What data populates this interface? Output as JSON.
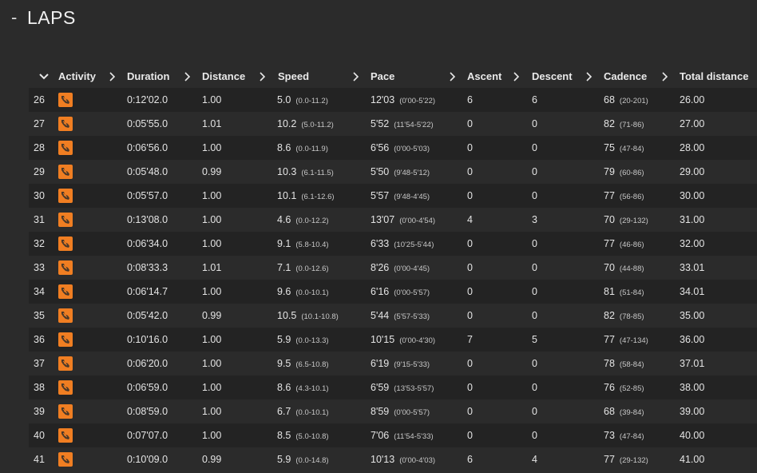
{
  "section": {
    "toggle": "-",
    "title": "LAPS"
  },
  "columns": [
    {
      "key": "activity",
      "label": "Activity"
    },
    {
      "key": "duration",
      "label": "Duration"
    },
    {
      "key": "distance",
      "label": "Distance"
    },
    {
      "key": "speed",
      "label": "Speed"
    },
    {
      "key": "pace",
      "label": "Pace"
    },
    {
      "key": "ascent",
      "label": "Ascent"
    },
    {
      "key": "descent",
      "label": "Descent"
    },
    {
      "key": "cadence",
      "label": "Cadence"
    },
    {
      "key": "total_distance",
      "label": "Total distance"
    }
  ],
  "activity_icon": "running-shoe-icon",
  "accent_color": "#f07e22",
  "laps": [
    {
      "num": "26",
      "duration": "0:12'02.0",
      "distance": "1.00",
      "speed": "5.0",
      "speed_range": "(0.0-11.2)",
      "pace": "12'03",
      "pace_range": "(0'00-5'22)",
      "ascent": "6",
      "descent": "6",
      "cadence": "68",
      "cadence_range": "(20-201)",
      "total": "26.00"
    },
    {
      "num": "27",
      "duration": "0:05'55.0",
      "distance": "1.01",
      "speed": "10.2",
      "speed_range": "(5.0-11.2)",
      "pace": "5'52",
      "pace_range": "(11'54-5'22)",
      "ascent": "0",
      "descent": "0",
      "cadence": "82",
      "cadence_range": "(71-86)",
      "total": "27.00"
    },
    {
      "num": "28",
      "duration": "0:06'56.0",
      "distance": "1.00",
      "speed": "8.6",
      "speed_range": "(0.0-11.9)",
      "pace": "6'56",
      "pace_range": "(0'00-5'03)",
      "ascent": "0",
      "descent": "0",
      "cadence": "75",
      "cadence_range": "(47-84)",
      "total": "28.00"
    },
    {
      "num": "29",
      "duration": "0:05'48.0",
      "distance": "0.99",
      "speed": "10.3",
      "speed_range": "(6.1-11.5)",
      "pace": "5'50",
      "pace_range": "(9'48-5'12)",
      "ascent": "0",
      "descent": "0",
      "cadence": "79",
      "cadence_range": "(60-86)",
      "total": "29.00"
    },
    {
      "num": "30",
      "duration": "0:05'57.0",
      "distance": "1.00",
      "speed": "10.1",
      "speed_range": "(6.1-12.6)",
      "pace": "5'57",
      "pace_range": "(9'48-4'45)",
      "ascent": "0",
      "descent": "0",
      "cadence": "77",
      "cadence_range": "(56-86)",
      "total": "30.00"
    },
    {
      "num": "31",
      "duration": "0:13'08.0",
      "distance": "1.00",
      "speed": "4.6",
      "speed_range": "(0.0-12.2)",
      "pace": "13'07",
      "pace_range": "(0'00-4'54)",
      "ascent": "4",
      "descent": "3",
      "cadence": "70",
      "cadence_range": "(29-132)",
      "total": "31.00"
    },
    {
      "num": "32",
      "duration": "0:06'34.0",
      "distance": "1.00",
      "speed": "9.1",
      "speed_range": "(5.8-10.4)",
      "pace": "6'33",
      "pace_range": "(10'25-5'44)",
      "ascent": "0",
      "descent": "0",
      "cadence": "77",
      "cadence_range": "(46-86)",
      "total": "32.00"
    },
    {
      "num": "33",
      "duration": "0:08'33.3",
      "distance": "1.01",
      "speed": "7.1",
      "speed_range": "(0.0-12.6)",
      "pace": "8'26",
      "pace_range": "(0'00-4'45)",
      "ascent": "0",
      "descent": "0",
      "cadence": "70",
      "cadence_range": "(44-88)",
      "total": "33.01"
    },
    {
      "num": "34",
      "duration": "0:06'14.7",
      "distance": "1.00",
      "speed": "9.6",
      "speed_range": "(0.0-10.1)",
      "pace": "6'16",
      "pace_range": "(0'00-5'57)",
      "ascent": "0",
      "descent": "0",
      "cadence": "81",
      "cadence_range": "(51-84)",
      "total": "34.01"
    },
    {
      "num": "35",
      "duration": "0:05'42.0",
      "distance": "0.99",
      "speed": "10.5",
      "speed_range": "(10.1-10.8)",
      "pace": "5'44",
      "pace_range": "(5'57-5'33)",
      "ascent": "0",
      "descent": "0",
      "cadence": "82",
      "cadence_range": "(78-85)",
      "total": "35.00"
    },
    {
      "num": "36",
      "duration": "0:10'16.0",
      "distance": "1.00",
      "speed": "5.9",
      "speed_range": "(0.0-13.3)",
      "pace": "10'15",
      "pace_range": "(0'00-4'30)",
      "ascent": "7",
      "descent": "5",
      "cadence": "77",
      "cadence_range": "(47-134)",
      "total": "36.00"
    },
    {
      "num": "37",
      "duration": "0:06'20.0",
      "distance": "1.00",
      "speed": "9.5",
      "speed_range": "(6.5-10.8)",
      "pace": "6'19",
      "pace_range": "(9'15-5'33)",
      "ascent": "0",
      "descent": "0",
      "cadence": "78",
      "cadence_range": "(58-84)",
      "total": "37.01"
    },
    {
      "num": "38",
      "duration": "0:06'59.0",
      "distance": "1.00",
      "speed": "8.6",
      "speed_range": "(4.3-10.1)",
      "pace": "6'59",
      "pace_range": "(13'53-5'57)",
      "ascent": "0",
      "descent": "0",
      "cadence": "76",
      "cadence_range": "(52-85)",
      "total": "38.00"
    },
    {
      "num": "39",
      "duration": "0:08'59.0",
      "distance": "1.00",
      "speed": "6.7",
      "speed_range": "(0.0-10.1)",
      "pace": "8'59",
      "pace_range": "(0'00-5'57)",
      "ascent": "0",
      "descent": "0",
      "cadence": "68",
      "cadence_range": "(39-84)",
      "total": "39.00"
    },
    {
      "num": "40",
      "duration": "0:07'07.0",
      "distance": "1.00",
      "speed": "8.5",
      "speed_range": "(5.0-10.8)",
      "pace": "7'06",
      "pace_range": "(11'54-5'33)",
      "ascent": "0",
      "descent": "0",
      "cadence": "73",
      "cadence_range": "(47-84)",
      "total": "40.00"
    },
    {
      "num": "41",
      "duration": "0:10'09.0",
      "distance": "0.99",
      "speed": "5.9",
      "speed_range": "(0.0-14.8)",
      "pace": "10'13",
      "pace_range": "(0'00-4'03)",
      "ascent": "6",
      "descent": "4",
      "cadence": "77",
      "cadence_range": "(29-132)",
      "total": "41.00"
    }
  ]
}
